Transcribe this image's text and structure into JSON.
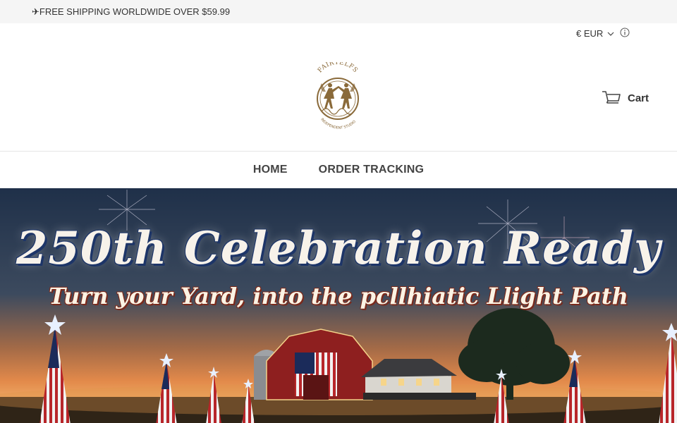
{
  "announcement": {
    "text": "✈FREE SHIPPING WORLDWIDE OVER $59.99"
  },
  "header": {
    "currency": "€ EUR",
    "cart_label": "Cart",
    "logo_text_top": "FAIRYELFS",
    "logo_text_bottom": "INDEPENDENT STUDIO"
  },
  "nav": {
    "items": [
      {
        "label": "HOME"
      },
      {
        "label": "ORDER TRACKING"
      }
    ]
  },
  "hero": {
    "title": "250th Celebration Ready",
    "subtitle": "Turn your Yard, into the pcllhiatic Llight Path"
  },
  "colors": {
    "announcement_bg": "#f5f5f5",
    "logo_gold": "#8a6a3a",
    "text_dark": "#333333"
  },
  "icons": {
    "currency_chevron": "chevron-down-icon",
    "info": "info-icon",
    "cart": "cart-icon"
  }
}
